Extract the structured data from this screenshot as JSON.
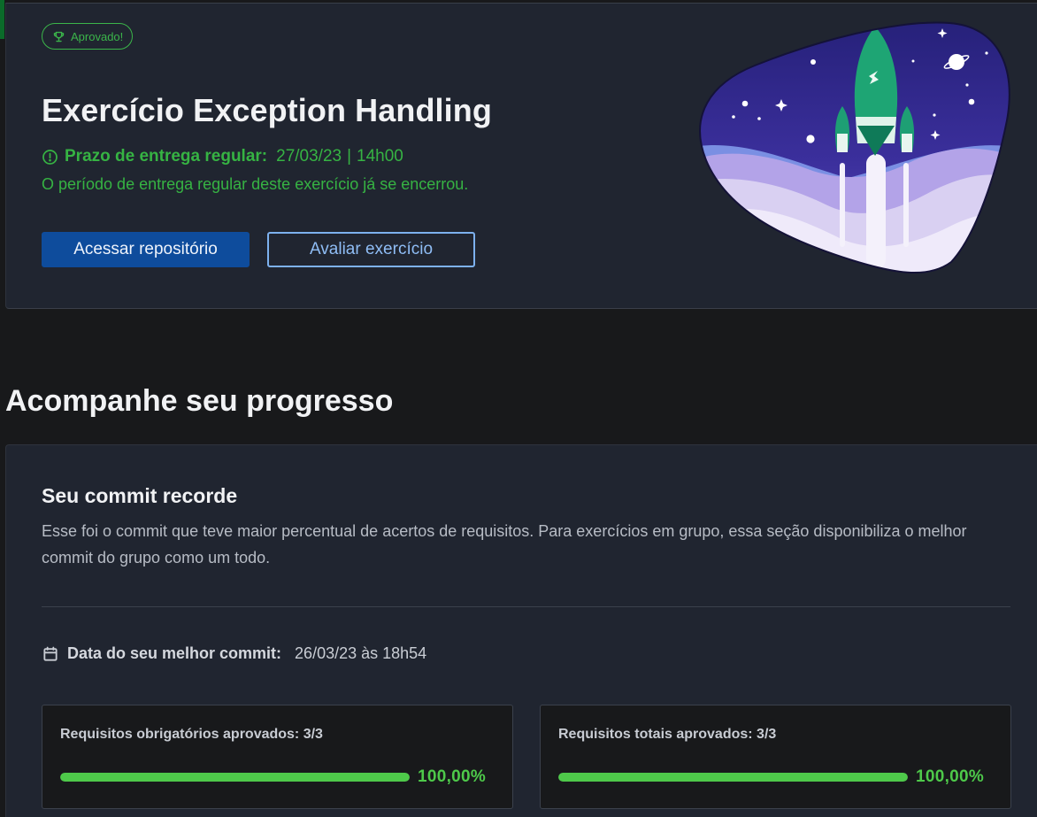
{
  "header": {
    "badge_label": "Aprovado!",
    "title": "Exercício Exception Handling",
    "deadline_label": "Prazo de entrega regular:",
    "deadline_date": "27/03/23",
    "deadline_separator": "|",
    "deadline_time": "14h00",
    "deadline_note": "O período de entrega regular deste exercício já se encerrou.",
    "primary_button": "Acessar repositório",
    "secondary_button": "Avaliar exercício"
  },
  "icons": {
    "badge": "trophy-icon",
    "deadline": "alert-circle-icon",
    "best_commit": "calendar-icon"
  },
  "progress": {
    "section_title": "Acompanhe seu progresso",
    "card_title": "Seu commit recorde",
    "card_description": "Esse foi o commit que teve maior percentual de acertos de requisitos. Para exercícios em grupo, essa seção disponibiliza o melhor commit do grupo como um todo.",
    "best_commit_label": "Data do seu melhor commit:",
    "best_commit_value": "26/03/23 às 18h54",
    "requirements": [
      {
        "label": "Requisitos obrigatórios aprovados: 3/3",
        "progress_fraction": 1.0,
        "percent_text": "100,00%"
      },
      {
        "label": "Requisitos totais aprovados: 3/3",
        "progress_fraction": 1.0,
        "percent_text": "100,00%"
      }
    ]
  },
  "colors": {
    "success": "#36b343",
    "primary_button": "#0e4c9c",
    "outline_button": "#7db1ee",
    "progress_bar": "#4ec94a",
    "card_background": "#202530",
    "page_background": "#18191b"
  }
}
